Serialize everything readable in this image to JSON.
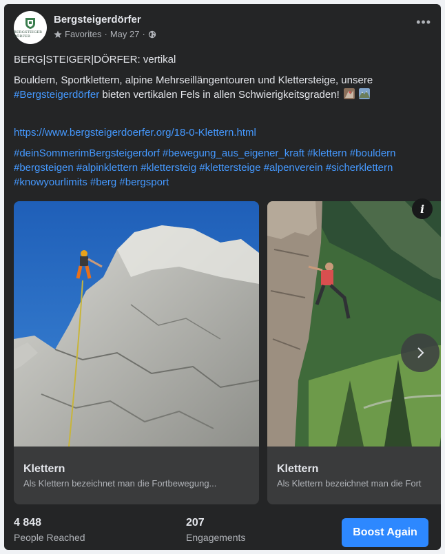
{
  "header": {
    "page_name": "Bergsteigerdörfer",
    "avatar_text": "BERGSTEIGER DÖRFER",
    "audience": "Favorites",
    "date": "May 27",
    "separator": "·",
    "more_label": "•••"
  },
  "post": {
    "title": "BERG|STEIGER|DÖRFER: vertikal",
    "body_part1": "Bouldern, Sportklettern, alpine Mehrseillängentouren und Klettersteige, unsere ",
    "body_hashtag": "#Bergsteigerdörfer",
    "body_part2": " bieten vertikalen Fels in allen Schwierigkeitsgraden!",
    "url": "https://www.bergsteigerdoerfer.org/18-0-Klettern.html",
    "hashtags": "#deinSommerimBergsteigerdorf #bewegung_aus_eigener_kraft #klettern #bouldern #bergsteigen #alpinklettern #klettersteig #klettersteige #alpenverein #sicherklettern #knowyourlimits #berg #bergsport"
  },
  "carousel": {
    "info_label": "i",
    "cards": [
      {
        "title": "Klettern",
        "desc": "Als Klettern bezeichnet man die Fortbewegung..."
      },
      {
        "title": "Klettern",
        "desc": "Als Klettern bezeichnet man die Fort"
      }
    ]
  },
  "stats": {
    "reached_value": "4 848",
    "reached_label": "People Reached",
    "engagements_value": "207",
    "engagements_label": "Engagements",
    "boost_label": "Boost Again"
  },
  "colors": {
    "background": "#242526",
    "link": "#4599ff",
    "boost_button": "#2d88ff"
  },
  "icons": [
    "star-icon",
    "globe-icon",
    "more-icon",
    "info-icon",
    "chevron-right-icon"
  ]
}
